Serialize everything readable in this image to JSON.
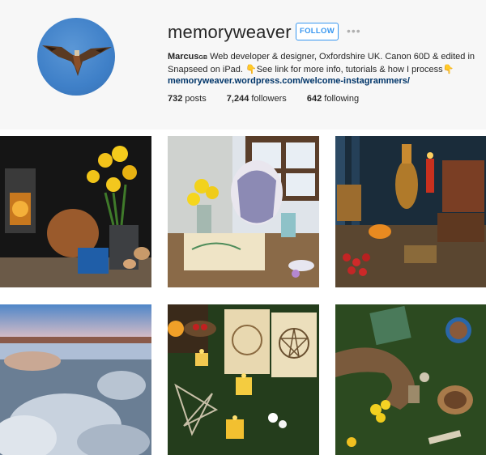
{
  "profile": {
    "username": "memoryweaver",
    "follow_label": "FOLLOW",
    "more_label": "•••",
    "bio_name": "Marcus",
    "bio_flag": "GB",
    "bio_text": " Web developer & designer, Oxfordshire UK. Canon 60D & edited in Snapseed on iPad. 👇See link for more info, tutorials & how I process👇",
    "bio_link": "memoryweaver.wordpress.com/welcome-instagrammers/"
  },
  "stats": {
    "posts_count": "732",
    "posts_label": "posts",
    "followers_count": "7,244",
    "followers_label": "followers",
    "following_count": "642",
    "following_label": "following"
  },
  "posts": [
    {
      "name": "still-life-lantern-daffodils"
    },
    {
      "name": "still-life-jug-daffodils-book"
    },
    {
      "name": "still-life-brass-apothecary"
    },
    {
      "name": "frosty-marsh-landscape"
    },
    {
      "name": "candles-pentagram-book"
    },
    {
      "name": "antler-moss-tea-cup"
    }
  ],
  "colors": {
    "accent": "#3897f0",
    "link": "#003569",
    "header_bg": "#f7f7f7"
  }
}
